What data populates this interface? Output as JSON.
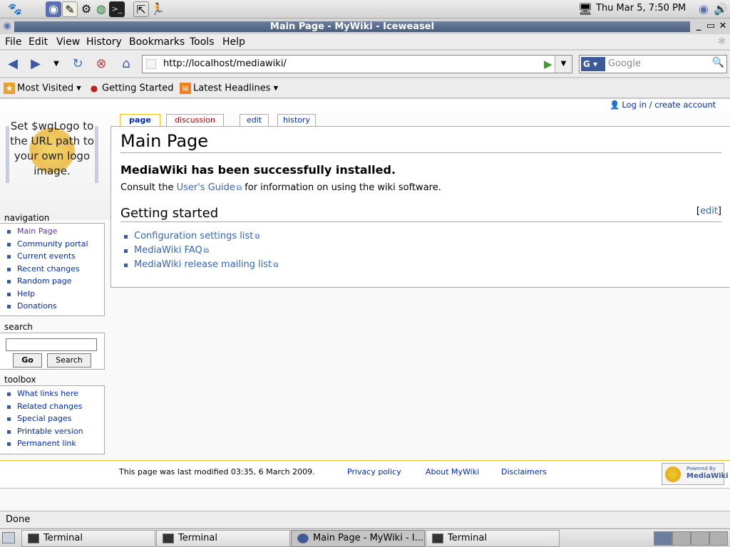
{
  "top_panel": {
    "clock": "Thu Mar  5,  7:50 PM",
    "launchers": [
      "gnome-foot-icon",
      "browser-icon",
      "text-editor-icon",
      "file-manager-icon",
      "globe-icon",
      "terminal-icon",
      "screenshot-icon",
      "run-icon"
    ]
  },
  "window": {
    "title": "Main Page - MyWiki - Iceweasel"
  },
  "menu": {
    "items": [
      "File",
      "Edit",
      "View",
      "History",
      "Bookmarks",
      "Tools",
      "Help"
    ]
  },
  "navbar": {
    "url": "http://localhost/mediawiki/",
    "search_placeholder": "Google",
    "search_engine": "G"
  },
  "bookmarks": {
    "items": [
      "Most Visited",
      "Getting Started",
      "Latest Headlines"
    ]
  },
  "wiki": {
    "personal_link": "Log in / create account",
    "logo_text": "Set $wgLogo to the URL path to your own logo image.",
    "tabs": [
      "page",
      "discussion",
      "edit",
      "history"
    ],
    "first_heading": "Main Page",
    "installed": "MediaWiki has been successfully installed.",
    "consult_before": "Consult the ",
    "consult_link": "User's Guide",
    "consult_after": " for information on using the wiki software.",
    "getting_started": "Getting started",
    "edit_section": "[edit]",
    "getting_started_links": [
      "Configuration settings list",
      "MediaWiki FAQ",
      "MediaWiki release mailing list"
    ],
    "navigation_title": "navigation",
    "navigation": [
      "Main Page",
      "Community portal",
      "Current events",
      "Recent changes",
      "Random page",
      "Help",
      "Donations"
    ],
    "search_title": "search",
    "search_go": "Go",
    "search_search": "Search",
    "toolbox_title": "toolbox",
    "toolbox": [
      "What links here",
      "Related changes",
      "Special pages",
      "Printable version",
      "Permanent link"
    ],
    "footer_lastmod": "This page was last modified 03:35, 6 March 2009.",
    "footer_links": [
      "Privacy policy",
      "About MyWiki",
      "Disclaimers"
    ],
    "powered_small": "Powered By",
    "powered_big": "MediaWiki"
  },
  "status": {
    "text": "Done"
  },
  "taskbar": {
    "tasks": [
      "Terminal",
      "Terminal",
      "Main Page - MyWiki - I...",
      "Terminal"
    ]
  },
  "colors": {
    "link": "#3366bb",
    "nav_link": "#002bb8",
    "new_link": "#ba0000",
    "selected_tab_border": "#fabd23",
    "titlebar": "#4a5f7e"
  }
}
